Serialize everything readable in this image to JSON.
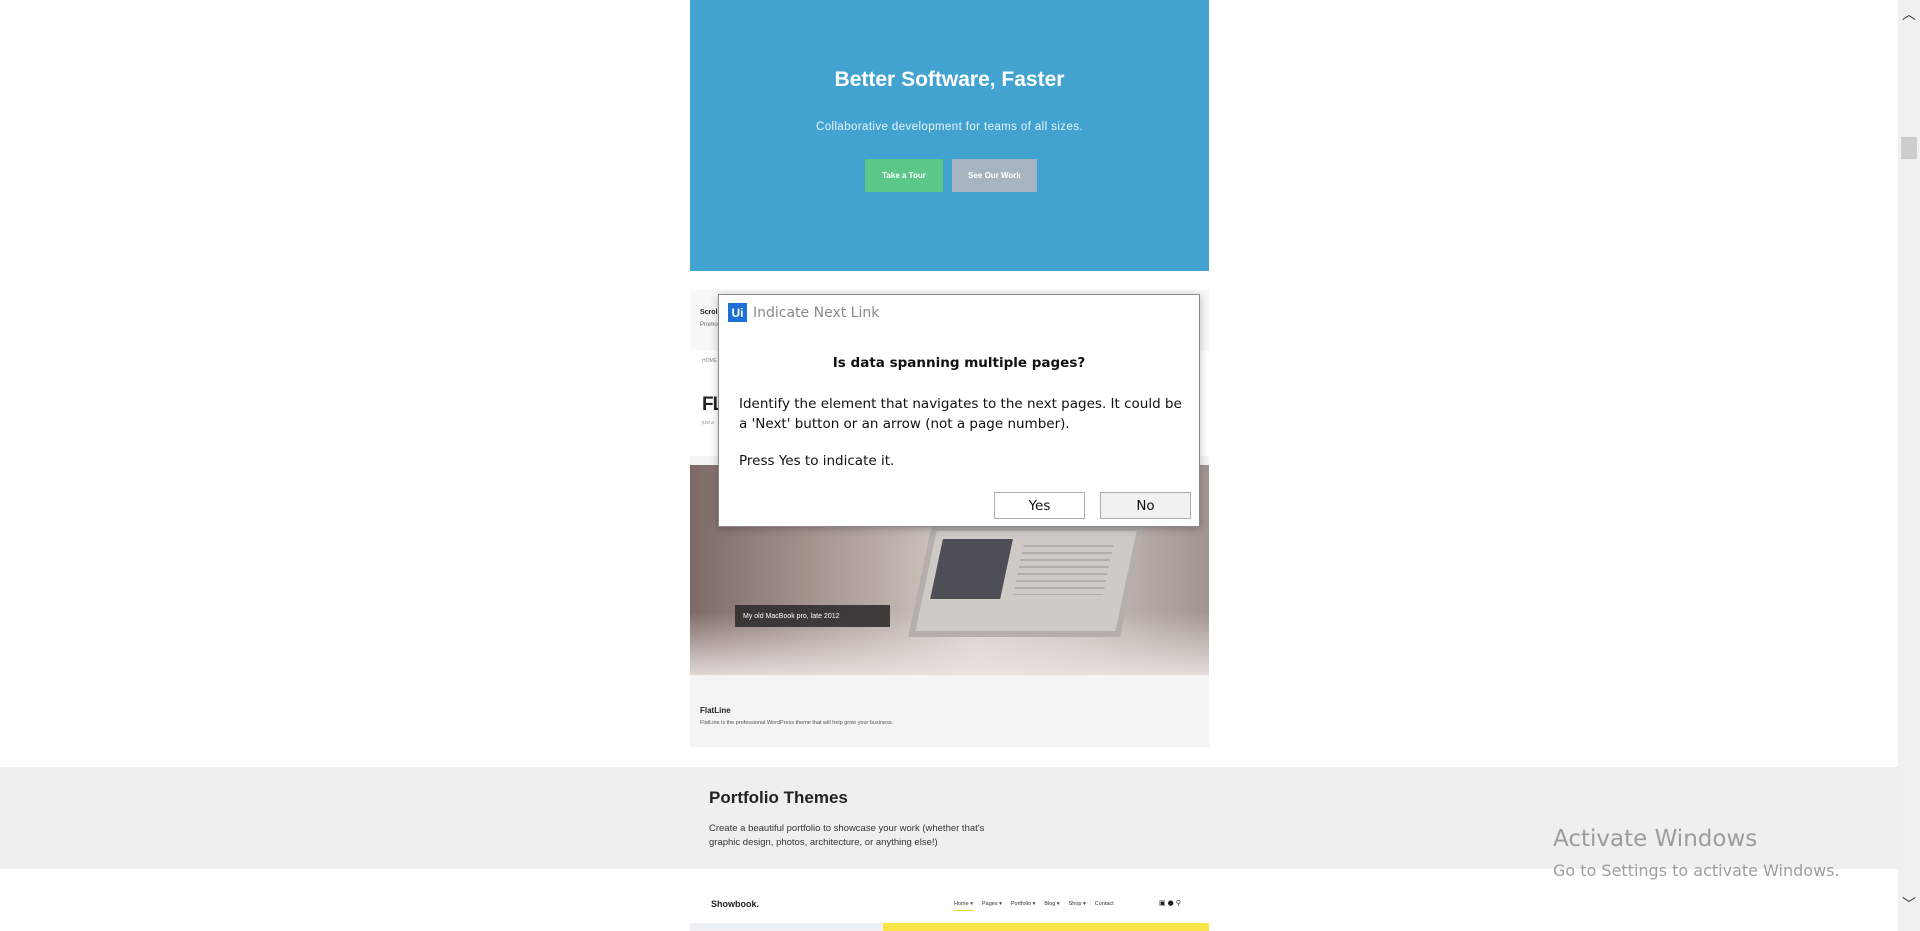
{
  "hero": {
    "title": "Better Software, Faster",
    "subtitle": "Collaborative development for teams of all sizes.",
    "tour_button": "Take a Tour",
    "work_button": "See Our Work"
  },
  "flatline_card": {
    "partial_title": "Scrol",
    "partial_subtitle": "Promo",
    "nav_home": "HOME",
    "logo_partial": "FLA",
    "tagline_partial": "just a",
    "photo_caption": "My old MacBook pro, late 2012",
    "footer_title": "FlatLine",
    "footer_desc": "FlatLine is the professional WordPress theme that will help grow your business."
  },
  "portfolio": {
    "title": "Portfolio Themes",
    "description": "Create a beautiful portfolio to showcase your work (whether that's graphic design, photos, architecture, or anything else!)"
  },
  "showbook": {
    "logo": "Showbook.",
    "nav": [
      "Home ▾",
      "Pages ▾",
      "Portfolio ▾",
      "Blog ▾",
      "Shop ▾",
      "Contact"
    ]
  },
  "dialog": {
    "icon_text": "Ui",
    "title": "Indicate Next Link",
    "heading": "Is data spanning multiple pages?",
    "body": "Identify the element that navigates to the next pages. It could be a 'Next' button or an arrow (not a page number).",
    "instruction": "Press Yes to indicate it.",
    "yes_label": "Yes",
    "no_label": "No"
  },
  "watermark": {
    "line1": "Activate Windows",
    "line2": "Go to Settings to activate Windows."
  },
  "icons": {
    "scroll_up": "chevron-up-icon",
    "scroll_down": "chevron-down-icon",
    "cart": "cart-icon",
    "user": "user-icon",
    "search": "search-icon"
  }
}
